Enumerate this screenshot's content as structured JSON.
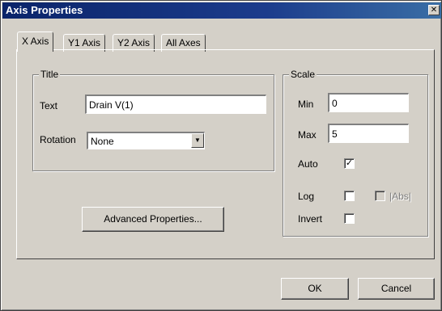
{
  "window": {
    "title": "Axis Properties",
    "close_glyph": "✕"
  },
  "tabs": [
    {
      "label": "X Axis",
      "active": true
    },
    {
      "label": "Y1 Axis",
      "active": false
    },
    {
      "label": "Y2 Axis",
      "active": false
    },
    {
      "label": "All Axes",
      "active": false
    }
  ],
  "title_group": {
    "legend": "Title",
    "text_label": "Text",
    "text_value": "Drain V(1)",
    "rotation_label": "Rotation",
    "rotation_value": "None"
  },
  "scale_group": {
    "legend": "Scale",
    "min_label": "Min",
    "min_value": "0",
    "max_label": "Max",
    "max_value": "5",
    "auto_label": "Auto",
    "auto_checked": true,
    "log_label": "Log",
    "log_checked": false,
    "abs_label": "|Abs|",
    "abs_checked": false,
    "invert_label": "Invert",
    "invert_checked": false
  },
  "buttons": {
    "advanced": "Advanced Properties...",
    "ok": "OK",
    "cancel": "Cancel"
  },
  "icons": {
    "dropdown_arrow": "▼",
    "check_mark": "✓"
  }
}
